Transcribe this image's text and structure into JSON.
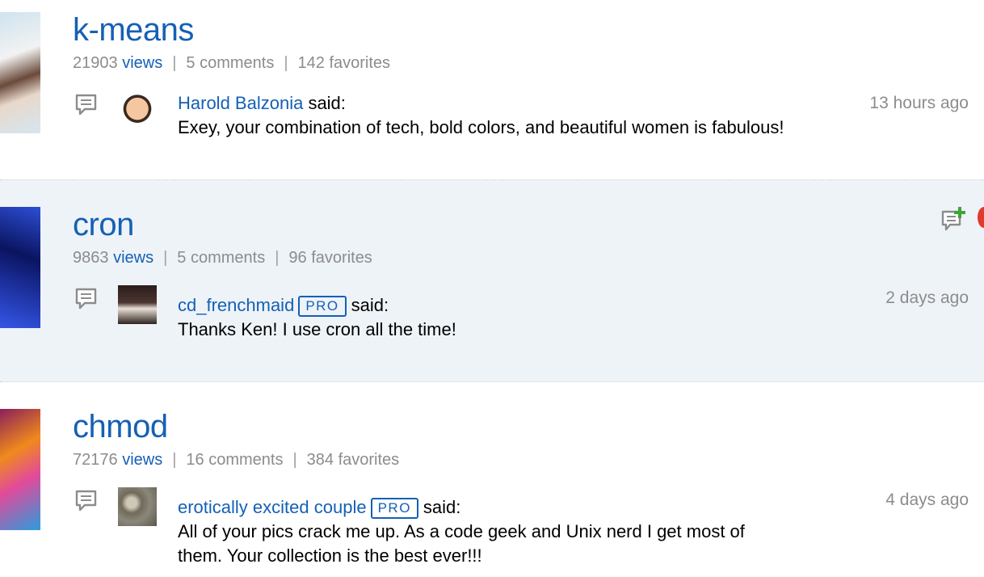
{
  "items": [
    {
      "title": "k-means",
      "views_count": "21903",
      "views_label": "views",
      "comments": "5 comments",
      "favorites": "142 favorites",
      "comment": {
        "author": "Harold Balzonia",
        "pro": "",
        "said": "said:",
        "text": "Exey, your combination of tech, bold colors, and beautiful women is fabulous!",
        "time": "13 hours ago"
      }
    },
    {
      "title": "cron",
      "views_count": "9863",
      "views_label": "views",
      "comments": "5 comments",
      "favorites": "96 favorites",
      "comment": {
        "author": "cd_frenchmaid",
        "pro": "PRO",
        "said": "said:",
        "text": "Thanks Ken! I use cron all the time!",
        "time": "2 days ago"
      }
    },
    {
      "title": "chmod",
      "views_count": "72176",
      "views_label": "views",
      "comments": "16 comments",
      "favorites": "384 favorites",
      "comment": {
        "author": "erotically excited couple",
        "pro": "PRO",
        "said": "said:",
        "text_line1": "All of your pics crack me up. As a code geek and Unix nerd I get most of",
        "text_line2": "them. Your collection is the best ever!!!",
        "time": "4 days ago"
      }
    }
  ],
  "icons": {
    "comment": "speech-bubble-icon",
    "add_comment": "add-comment-icon"
  },
  "colors": {
    "link": "#1560b5",
    "meta": "#8c8c8c",
    "highlight_bg": "#eef3f8"
  }
}
